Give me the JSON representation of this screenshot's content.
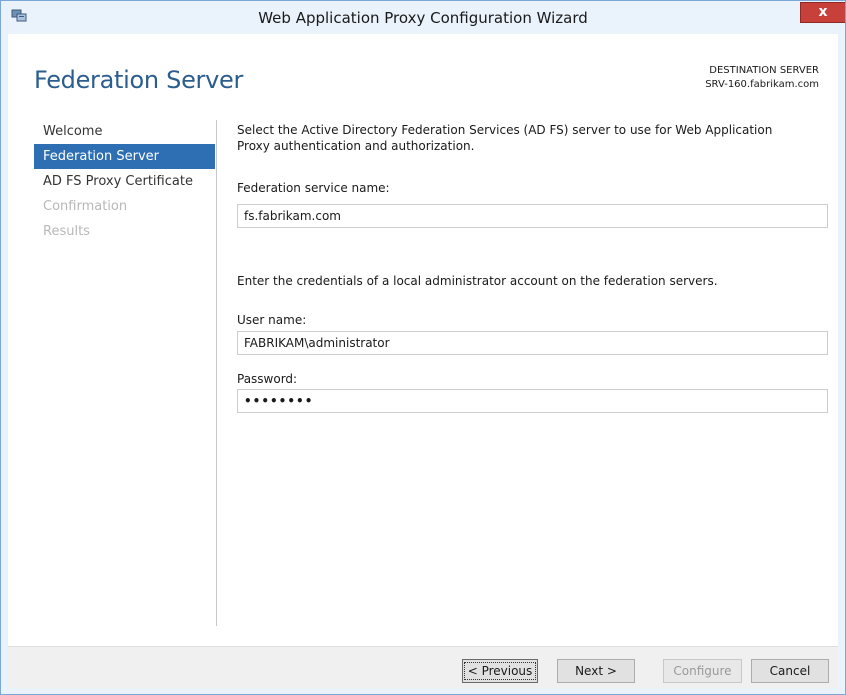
{
  "window": {
    "title": "Web Application Proxy Configuration Wizard",
    "close_label": "x"
  },
  "header": {
    "page_title": "Federation Server",
    "destination_label": "DESTINATION SERVER",
    "destination_value": "SRV-160.fabrikam.com"
  },
  "nav": {
    "items": [
      {
        "label": "Welcome",
        "state": "normal"
      },
      {
        "label": "Federation Server",
        "state": "active"
      },
      {
        "label": "AD FS Proxy Certificate",
        "state": "normal"
      },
      {
        "label": "Confirmation",
        "state": "disabled"
      },
      {
        "label": "Results",
        "state": "disabled"
      }
    ]
  },
  "content": {
    "intro": "Select the Active Directory Federation Services (AD FS) server to use for Web Application Proxy authentication and authorization.",
    "fed_label": "Federation service name:",
    "fed_value": "fs.fabrikam.com",
    "cred_text": "Enter the credentials of a local administrator account on the federation servers.",
    "user_label": "User name:",
    "user_value": "FABRIKAM\\administrator",
    "pw_label": "Password:",
    "pw_value": "••••••••"
  },
  "buttons": {
    "previous": "< Previous",
    "next": "Next >",
    "configure": "Configure",
    "cancel": "Cancel"
  },
  "colors": {
    "accent": "#2e6fb4",
    "title": "#2b5d8f",
    "close": "#c7403a"
  }
}
